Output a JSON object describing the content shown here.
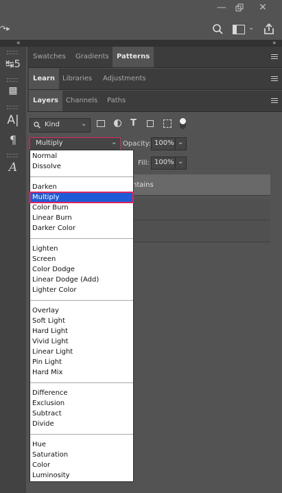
{
  "window": {
    "minimize_icon": "minimize-icon",
    "restore_icon": "restore-icon",
    "close_icon": "close-icon"
  },
  "panel_tabs_1": [
    "Swatches",
    "Gradients",
    "Patterns"
  ],
  "panel_tabs_2": [
    "Learn",
    "Libraries",
    "Adjustments"
  ],
  "panel_tabs_3": [
    "Layers",
    "Channels",
    "Paths"
  ],
  "layers": {
    "filter_kind": "Kind",
    "blend_mode": "Multiply",
    "opacity_label": "Opacity:",
    "opacity_value": "100%",
    "fill_label": "Fill:",
    "fill_value": "100%",
    "row_partial_text": "ntains"
  },
  "blend_menu": [
    [
      "Normal",
      "Dissolve"
    ],
    [
      "Darken",
      "Multiply",
      "Color Burn",
      "Linear Burn",
      "Darker Color"
    ],
    [
      "Lighten",
      "Screen",
      "Color Dodge",
      "Linear Dodge (Add)",
      "Lighter Color"
    ],
    [
      "Overlay",
      "Soft Light",
      "Hard Light",
      "Vivid Light",
      "Linear Light",
      "Pin Light",
      "Hard Mix"
    ],
    [
      "Difference",
      "Exclusion",
      "Subtract",
      "Divide"
    ],
    [
      "Hue",
      "Saturation",
      "Color",
      "Luminosity"
    ]
  ],
  "blend_selected": "Multiply",
  "colors": {
    "accent_outline": "#e0245e",
    "selection": "#1f5bd6"
  }
}
